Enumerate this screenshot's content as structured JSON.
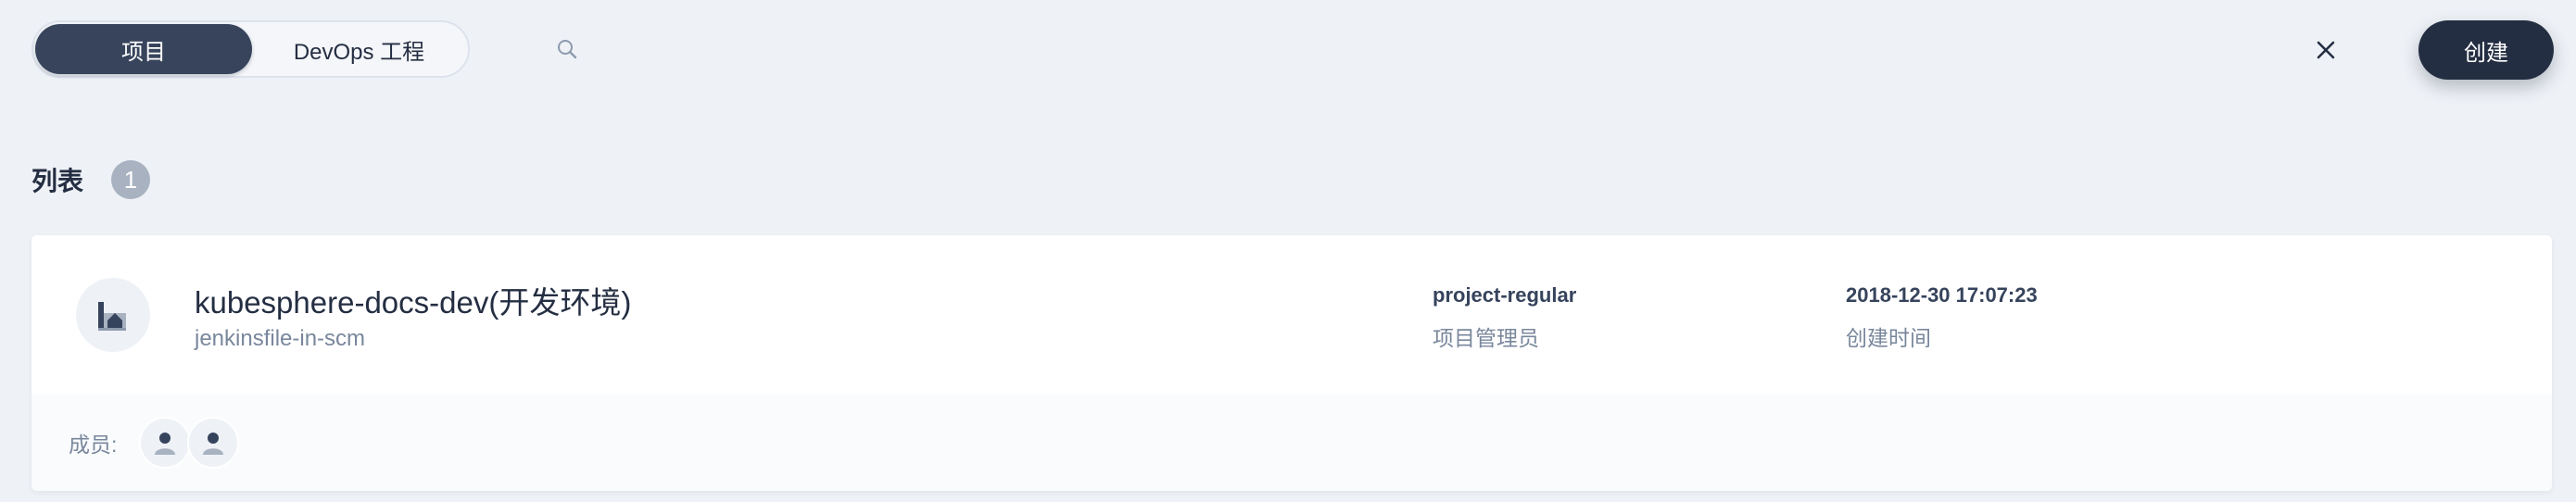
{
  "toolbar": {
    "tabs": [
      {
        "label": "项目",
        "active": true
      },
      {
        "label": "DevOps 工程",
        "active": false
      }
    ],
    "search": {
      "value": "",
      "placeholder": ""
    },
    "create_label": "创建"
  },
  "list": {
    "title": "列表",
    "count": "1"
  },
  "projects": [
    {
      "name": "kubesphere-docs-dev(开发环境)",
      "description": "jenkinsfile-in-scm",
      "role_value": "project-regular",
      "role_label": "项目管理员",
      "time_value": "2018-12-30 17:07:23",
      "time_label": "创建时间",
      "members_label": "成员:",
      "members": [
        "user-icon",
        "user-icon"
      ]
    }
  ],
  "colors": {
    "background": "#eef1f6",
    "primary_dark": "#242e42",
    "tab_active": "#37445c",
    "muted_text": "#79879c",
    "badge": "#a8b2c1"
  }
}
